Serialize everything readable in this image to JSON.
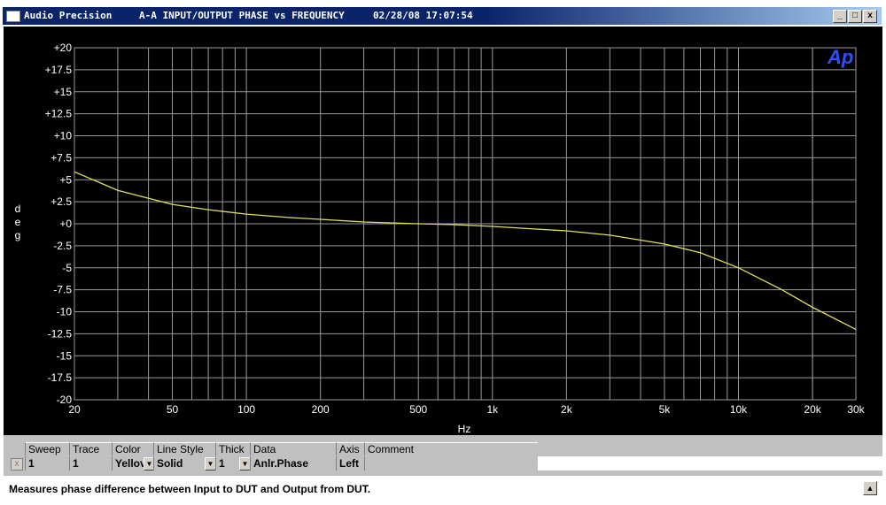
{
  "window": {
    "app_name": "Audio Precision",
    "graph_title": "A-A INPUT/OUTPUT PHASE vs FREQUENCY",
    "timestamp": "02/28/08 17:07:54",
    "minimize_glyph": "_",
    "restore_glyph": "□",
    "close_glyph": "x"
  },
  "chart_data": {
    "type": "line",
    "logo": "Ap",
    "xlabel": "Hz",
    "ylabel": "deg",
    "x_scale": "log",
    "xlim": [
      20,
      30000
    ],
    "ylim": [
      -20,
      20
    ],
    "grid": true,
    "background": "#000000",
    "grid_color": "#9a9a9a",
    "trace_color": "#e0e060",
    "y_ticks": [
      "+20",
      "+17.5",
      "+15",
      "+12.5",
      "+10",
      "+7.5",
      "+5",
      "+2.5",
      "+0",
      "-2.5",
      "-5",
      "-7.5",
      "-10",
      "-12.5",
      "-15",
      "-17.5",
      "-20"
    ],
    "x_ticks": [
      "20",
      "50",
      "100",
      "200",
      "500",
      "1k",
      "2k",
      "5k",
      "10k",
      "20k",
      "30k"
    ],
    "series": [
      {
        "x": [
          20,
          30,
          50,
          70,
          100,
          150,
          200,
          300,
          500,
          700,
          1000,
          1500,
          2000,
          3000,
          5000,
          7000,
          10000,
          15000,
          20000,
          30000
        ],
        "values": [
          5.9,
          3.8,
          2.2,
          1.6,
          1.1,
          0.7,
          0.5,
          0.2,
          0.0,
          -0.1,
          -0.3,
          -0.6,
          -0.8,
          -1.3,
          -2.3,
          -3.3,
          -5.0,
          -7.5,
          -9.5,
          -12.0
        ]
      }
    ]
  },
  "table": {
    "headers": [
      "Sweep",
      "Trace",
      "Color",
      "Line Style",
      "Thick",
      "Data",
      "Axis",
      "Comment"
    ],
    "row": {
      "checkbox_glyph": "x",
      "sweep": "1",
      "trace": "1",
      "color": "Yellov",
      "line_style": "Solid",
      "thick": "1",
      "data": "Anlr.Phase",
      "axis": "Left",
      "comment": ""
    }
  },
  "status": {
    "text": "Measures phase difference between Input to DUT and Output from DUT.",
    "scroll_glyph": "▲"
  }
}
